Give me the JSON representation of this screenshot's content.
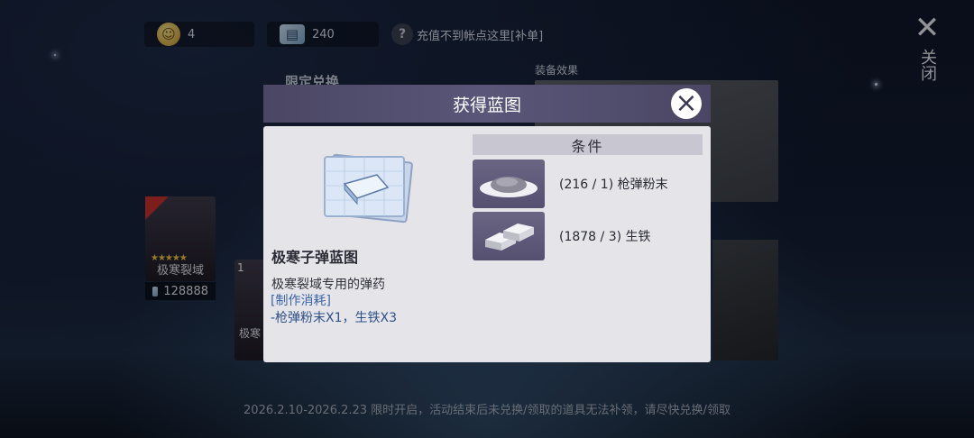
{
  "topbar": {
    "coins": {
      "icon": "coin-icon",
      "value": "4"
    },
    "tickets": {
      "icon": "ticket-icon",
      "value": "240"
    },
    "help_text": "充值不到帐点这里[补单]"
  },
  "background": {
    "section_title": "限定兑换",
    "equip_label": "装备效果",
    "close_label": "关闭",
    "cards": [
      {
        "name": "极寒裂域",
        "price": "128888",
        "badge": ""
      },
      {
        "name": "极寒",
        "price": "",
        "badge": "1"
      }
    ],
    "footer": "2026.2.10-2026.2.23 限时开启，活动结束后未兑换/领取的道具无法补领，请尽快兑换/领取"
  },
  "modal": {
    "title": "获得蓝图",
    "item_name": "极寒子弹蓝图",
    "item_desc": "极寒裂域专用的弹药",
    "cost_title": "[制作消耗]",
    "cost_detail": "-枪弹粉末X1，生铁X3",
    "conditions_title": "条件",
    "materials": [
      {
        "icon": "powder-icon",
        "text": "(216 / 1) 枪弹粉末"
      },
      {
        "icon": "iron-ingot-icon",
        "text": "(1878 / 3) 生铁"
      }
    ]
  },
  "colors": {
    "modal_header": "#5a5679",
    "modal_body": "#e4e4e9",
    "link_blue": "#3b64a6"
  }
}
